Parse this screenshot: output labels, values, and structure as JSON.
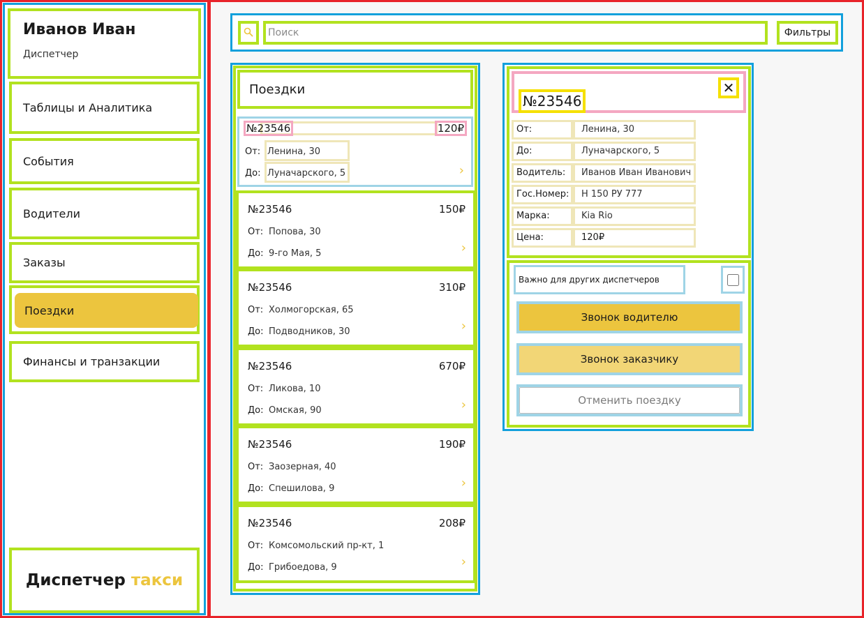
{
  "user": {
    "name": "Иванов Иван",
    "role": "Диспетчер"
  },
  "nav": [
    {
      "label": "Таблицы и Аналитика",
      "active": false
    },
    {
      "label": "События",
      "active": false
    },
    {
      "label": "Водители",
      "active": false
    },
    {
      "label": "Заказы",
      "active": false
    },
    {
      "label": "Поездки",
      "active": true
    },
    {
      "label": "Финансы и транзакции",
      "active": false
    }
  ],
  "brand": {
    "main": "Диспетчер",
    "accent": "такси"
  },
  "search": {
    "placeholder": "Поиск",
    "value": "",
    "filters_label": "Фильтры"
  },
  "trips": {
    "title": "Поездки",
    "from_label": "От:",
    "to_label": "До:",
    "items": [
      {
        "number": "№23546",
        "price": "120₽",
        "from": "Ленина, 30",
        "to": "Луначарского, 5",
        "selected": true
      },
      {
        "number": "№23546",
        "price": "150₽",
        "from": "Попова, 30",
        "to": "9-го Мая, 5"
      },
      {
        "number": "№23546",
        "price": "310₽",
        "from": "Холмогорская, 65",
        "to": "Подводников, 30"
      },
      {
        "number": "№23546",
        "price": "670₽",
        "from": "Ликова, 10",
        "to": "Омская, 90"
      },
      {
        "number": "№23546",
        "price": "190₽",
        "from": "Заозерная, 40",
        "to": "Спешилова, 9"
      },
      {
        "number": "№23546",
        "price": "208₽",
        "from": "Комсомольский пр-кт, 1",
        "to": "Грибоедова, 9"
      }
    ]
  },
  "detail": {
    "number": "№23546",
    "fields": [
      {
        "label": "От:",
        "value": "Ленина, 30"
      },
      {
        "label": "До:",
        "value": "Луначарского, 5"
      },
      {
        "label": "Водитель:",
        "value": "Иванов Иван Иванович"
      },
      {
        "label": "Гос.Номер:",
        "value": "Н 150 РУ 777"
      },
      {
        "label": "Марка:",
        "value": "Kia Rio"
      },
      {
        "label": "Цена:",
        "value": "120₽"
      }
    ],
    "important_label": "Важно для других диспетчеров",
    "important_checked": false,
    "call_driver_label": "Звонок водителю",
    "call_customer_label": "Звонок заказчику",
    "cancel_label": "Отменить поездку"
  },
  "colors": {
    "accent": "#ecc53e",
    "accent_light": "#f2d676"
  },
  "icons": {
    "search": "search-icon",
    "close": "close-icon",
    "chevron": "chevron-right-icon"
  }
}
